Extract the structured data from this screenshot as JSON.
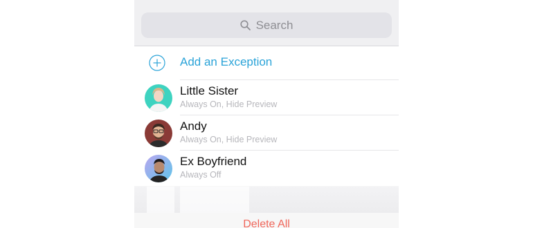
{
  "search": {
    "placeholder": "Search",
    "icon": "search-icon"
  },
  "add_exception": {
    "label": "Add an Exception",
    "icon": "plus-circle-icon",
    "color": "#2aa3d8"
  },
  "exceptions": [
    {
      "name": "Little Sister",
      "status": "Always On, Hide Preview"
    },
    {
      "name": "Andy",
      "status": "Always On, Hide Preview"
    },
    {
      "name": "Ex Boyfriend",
      "status": "Always Off"
    }
  ],
  "footer": {
    "delete_all_label": "Delete All",
    "color": "#f0675b"
  }
}
